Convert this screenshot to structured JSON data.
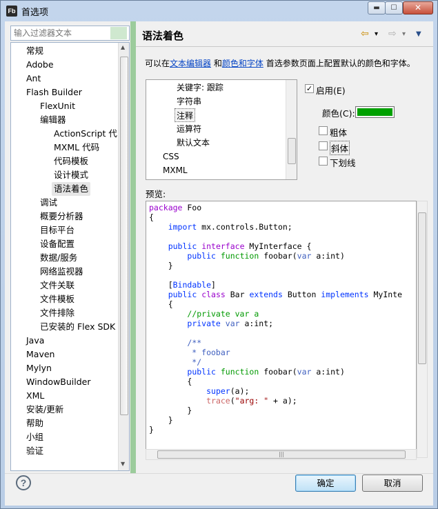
{
  "window": {
    "title": "首选项",
    "app_icon_text": "Fb",
    "min_glyph": "▬",
    "max_glyph": "☐",
    "close_glyph": "✕"
  },
  "filter": {
    "placeholder": "输入过滤器文本"
  },
  "tree": {
    "items": [
      {
        "label": "常规",
        "level": 0
      },
      {
        "label": "Adobe",
        "level": 0
      },
      {
        "label": "Ant",
        "level": 0
      },
      {
        "label": "Flash Builder",
        "level": 0
      },
      {
        "label": "FlexUnit",
        "level": 1
      },
      {
        "label": "编辑器",
        "level": 1
      },
      {
        "label": "ActionScript 代",
        "level": 2
      },
      {
        "label": "MXML 代码",
        "level": 2
      },
      {
        "label": "代码模板",
        "level": 2
      },
      {
        "label": "设计模式",
        "level": 2
      },
      {
        "label": "语法着色",
        "level": 2,
        "selected": true
      },
      {
        "label": "调试",
        "level": 1
      },
      {
        "label": "概要分析器",
        "level": 1
      },
      {
        "label": "目标平台",
        "level": 1
      },
      {
        "label": "设备配置",
        "level": 1
      },
      {
        "label": "数据/服务",
        "level": 1
      },
      {
        "label": "网络监视器",
        "level": 1
      },
      {
        "label": "文件关联",
        "level": 1
      },
      {
        "label": "文件模板",
        "level": 1
      },
      {
        "label": "文件排除",
        "level": 1
      },
      {
        "label": "已安装的 Flex SDK",
        "level": 1
      },
      {
        "label": "Java",
        "level": 0
      },
      {
        "label": "Maven",
        "level": 0
      },
      {
        "label": "Mylyn",
        "level": 0
      },
      {
        "label": "WindowBuilder",
        "level": 0
      },
      {
        "label": "XML",
        "level": 0
      },
      {
        "label": "安装/更新",
        "level": 0
      },
      {
        "label": "帮助",
        "level": 0
      },
      {
        "label": "小组",
        "level": 0
      },
      {
        "label": "验证",
        "level": 0
      }
    ]
  },
  "page": {
    "title": "语法着色",
    "nav_back": "⇦",
    "nav_back_menu": "▾",
    "nav_forward": "⇨",
    "nav_forward_menu": "▾",
    "view_menu": "▼",
    "desc_prefix": "可以在",
    "desc_link1": "文本编辑器",
    "desc_mid": " 和",
    "desc_link2": "颜色和字体",
    "desc_suffix": " 首选参数页面上配置默认的颜色和字体。"
  },
  "elements": {
    "items": [
      {
        "label": "关键字: 跟踪",
        "level": 2
      },
      {
        "label": "字符串",
        "level": 2
      },
      {
        "label": "注释",
        "level": 2,
        "selected": true
      },
      {
        "label": "运算符",
        "level": 2
      },
      {
        "label": "默认文本",
        "level": 2
      },
      {
        "label": "CSS",
        "level": 1
      },
      {
        "label": "MXML",
        "level": 1
      }
    ]
  },
  "options": {
    "enable_label": "启用(E)",
    "enable_checked": true,
    "color_label": "颜色(C):",
    "color_value": "#00a000",
    "bold_label": "粗体",
    "italic_label": "斜体",
    "underline_label": "下划线",
    "check_glyph": "✓"
  },
  "preview": {
    "label": "预览:",
    "hscroll_grip": "|||"
  },
  "buttons": {
    "ok": "确定",
    "cancel": "取消",
    "help": "?"
  },
  "colors": {
    "sash": "#9ccc9c",
    "link": "#0645c5",
    "keyword": "#0033ff",
    "keyword2": "#9900cc",
    "comment": "#009900",
    "doc_comment": "#3f5fbf",
    "string": "#990000"
  }
}
